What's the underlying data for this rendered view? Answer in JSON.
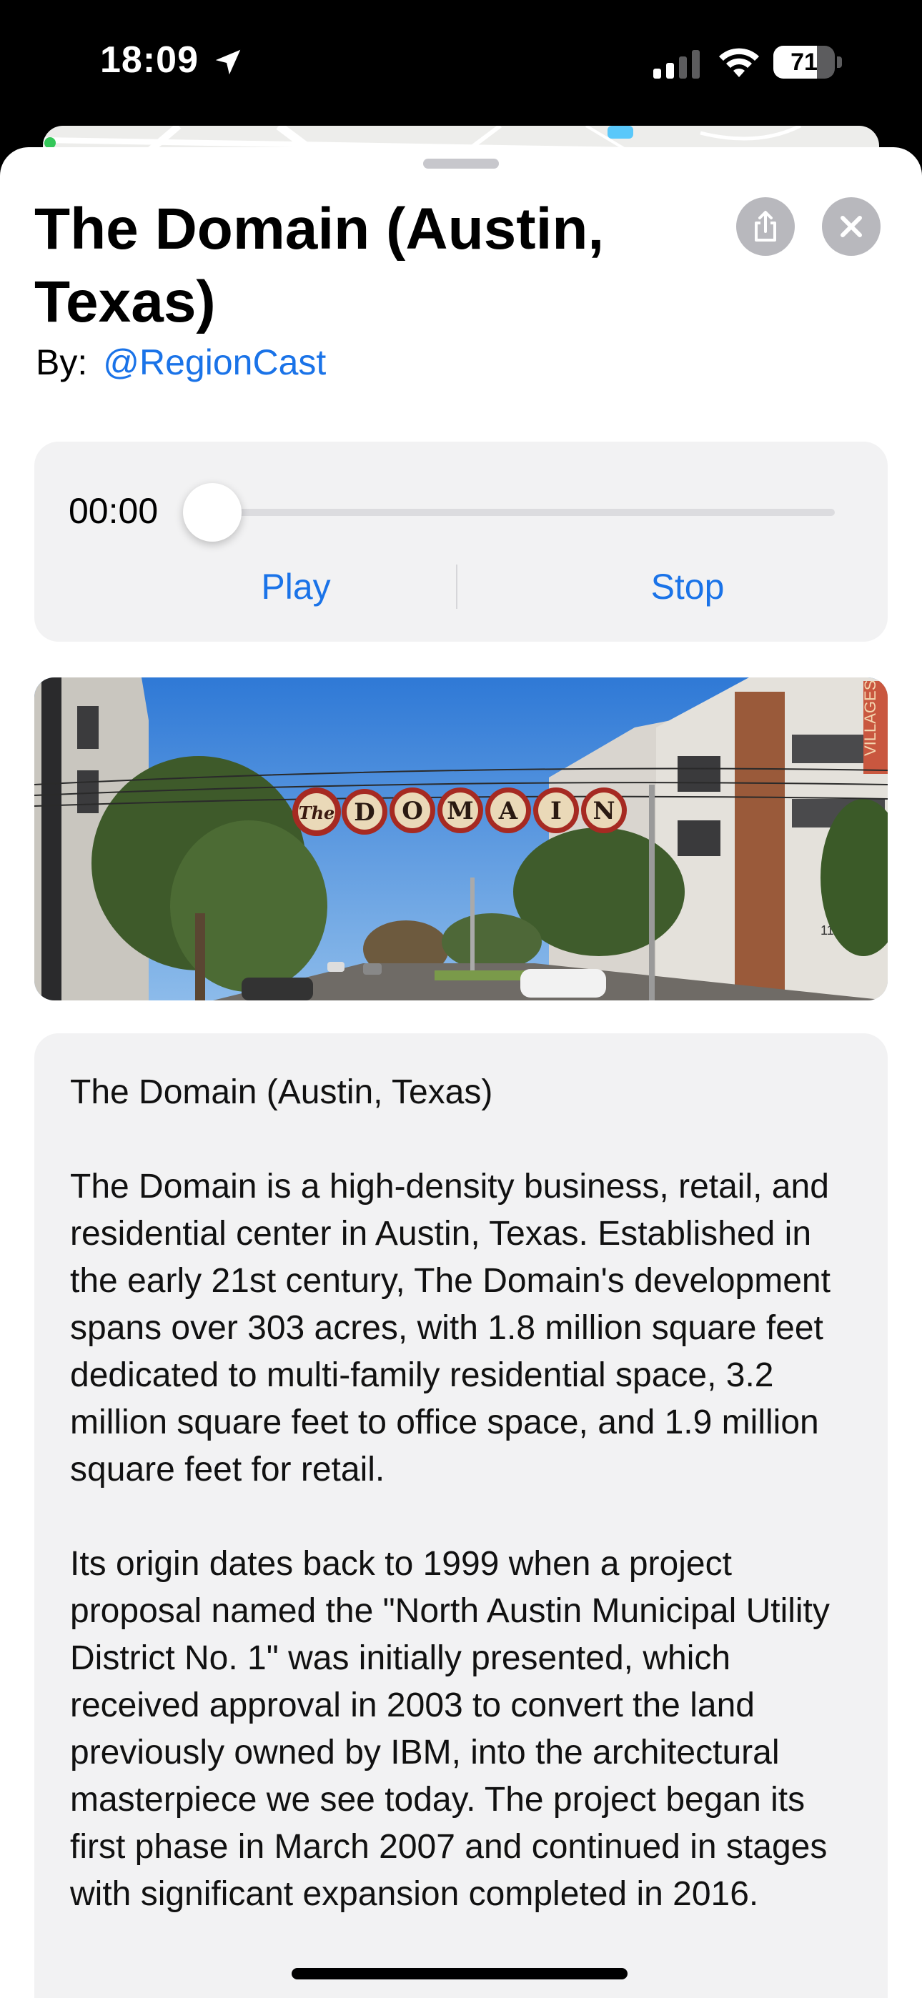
{
  "status_bar": {
    "time": "18:09",
    "battery_percent": "71",
    "battery_level": 0.71,
    "icons": [
      "location-arrow-icon",
      "cellular-signal-icon",
      "wifi-icon",
      "battery-icon"
    ]
  },
  "sheet": {
    "title": "The Domain (Austin, Texas)",
    "by_label": "By:",
    "author": "@RegionCast",
    "share_icon": "share-icon",
    "close_icon": "close-icon"
  },
  "player": {
    "time": "00:00",
    "progress": 0.0,
    "play_label": "Play",
    "stop_label": "Stop"
  },
  "photo": {
    "sign_text": "DOMAIN",
    "sign_script": "The",
    "building_sign": "VILLAGES",
    "address_number": "11011"
  },
  "description": {
    "heading": "The Domain (Austin, Texas)",
    "paragraphs": [
      "The Domain is a high-density business, retail, and residential center in Austin, Texas. Established in the early 21st century, The Domain's development spans over 303 acres, with 1.8 million square feet dedicated to multi-family residential space, 3.2 million square feet to office space, and 1.9 million square feet for retail.",
      "Its origin dates back to 1999 when a project proposal named the \"North Austin Municipal Utility District No. 1\" was initially presented, which received approval in 2003 to convert the land previously owned by IBM, into the architectural masterpiece we see today. The project began its first phase in March 2007 and continued in stages with significant expansion completed in 2016."
    ]
  },
  "colors": {
    "accent": "#1a73e8",
    "card_background": "#f2f2f3",
    "circle_button": "#b8b8bd"
  }
}
